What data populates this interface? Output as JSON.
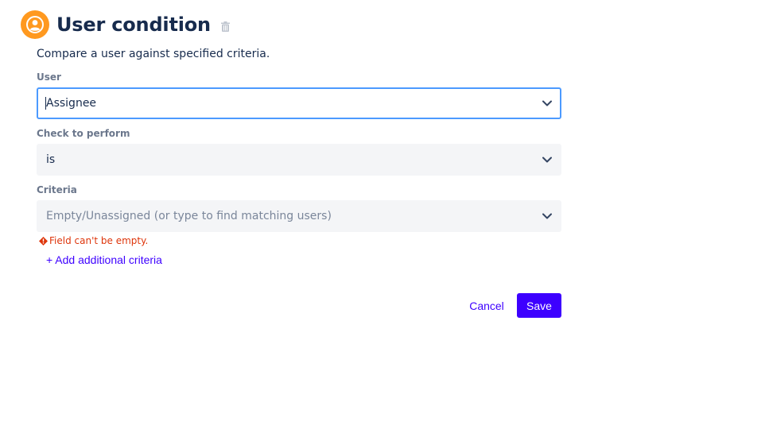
{
  "header": {
    "title": "User condition",
    "icon": "user-circle-icon",
    "icon_color": "#FF991F",
    "delete_icon": "trash-icon"
  },
  "description": "Compare a user against specified criteria.",
  "fields": {
    "user": {
      "label": "User",
      "value": "Assignee",
      "focused": true
    },
    "check": {
      "label": "Check to perform",
      "value": "is"
    },
    "criteria": {
      "label": "Criteria",
      "placeholder": "Empty/Unassigned (or type to find matching users)",
      "value": ""
    }
  },
  "error": {
    "text": "Field can't be empty.",
    "color": "#DE350B"
  },
  "add_criteria_label": "+ Add additional criteria",
  "actions": {
    "cancel_label": "Cancel",
    "save_label": "Save",
    "accent": "#3D00FF"
  }
}
